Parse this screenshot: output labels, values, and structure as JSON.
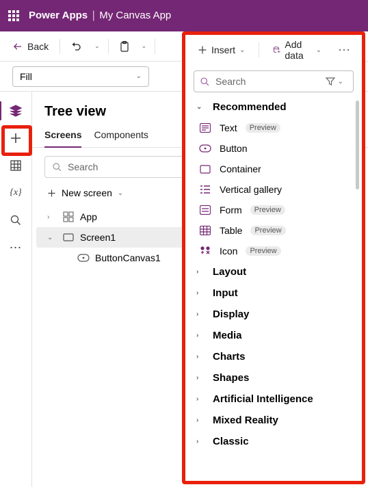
{
  "colors": {
    "brand": "#742774",
    "highlight": "#e8200c"
  },
  "header": {
    "product": "Power Apps",
    "app": "My Canvas App"
  },
  "toolbar": {
    "back": "Back",
    "insert": "Insert",
    "add_data": "Add data"
  },
  "property": {
    "selected": "Fill"
  },
  "tree": {
    "title": "Tree view",
    "tabs": {
      "screens": "Screens",
      "components": "Components"
    },
    "search_placeholder": "Search",
    "new_screen": "New screen",
    "nodes": {
      "app": "App",
      "screen1": "Screen1",
      "button": "ButtonCanvas1"
    }
  },
  "insert_panel": {
    "search_placeholder": "Search",
    "recommended_label": "Recommended",
    "preview_label": "Preview",
    "items": {
      "text": "Text",
      "button": "Button",
      "container": "Container",
      "vgallery": "Vertical gallery",
      "form": "Form",
      "table": "Table",
      "icon": "Icon"
    },
    "categories": {
      "layout": "Layout",
      "input": "Input",
      "display": "Display",
      "media": "Media",
      "charts": "Charts",
      "shapes": "Shapes",
      "ai": "Artificial Intelligence",
      "mixed": "Mixed Reality",
      "classic": "Classic"
    }
  }
}
